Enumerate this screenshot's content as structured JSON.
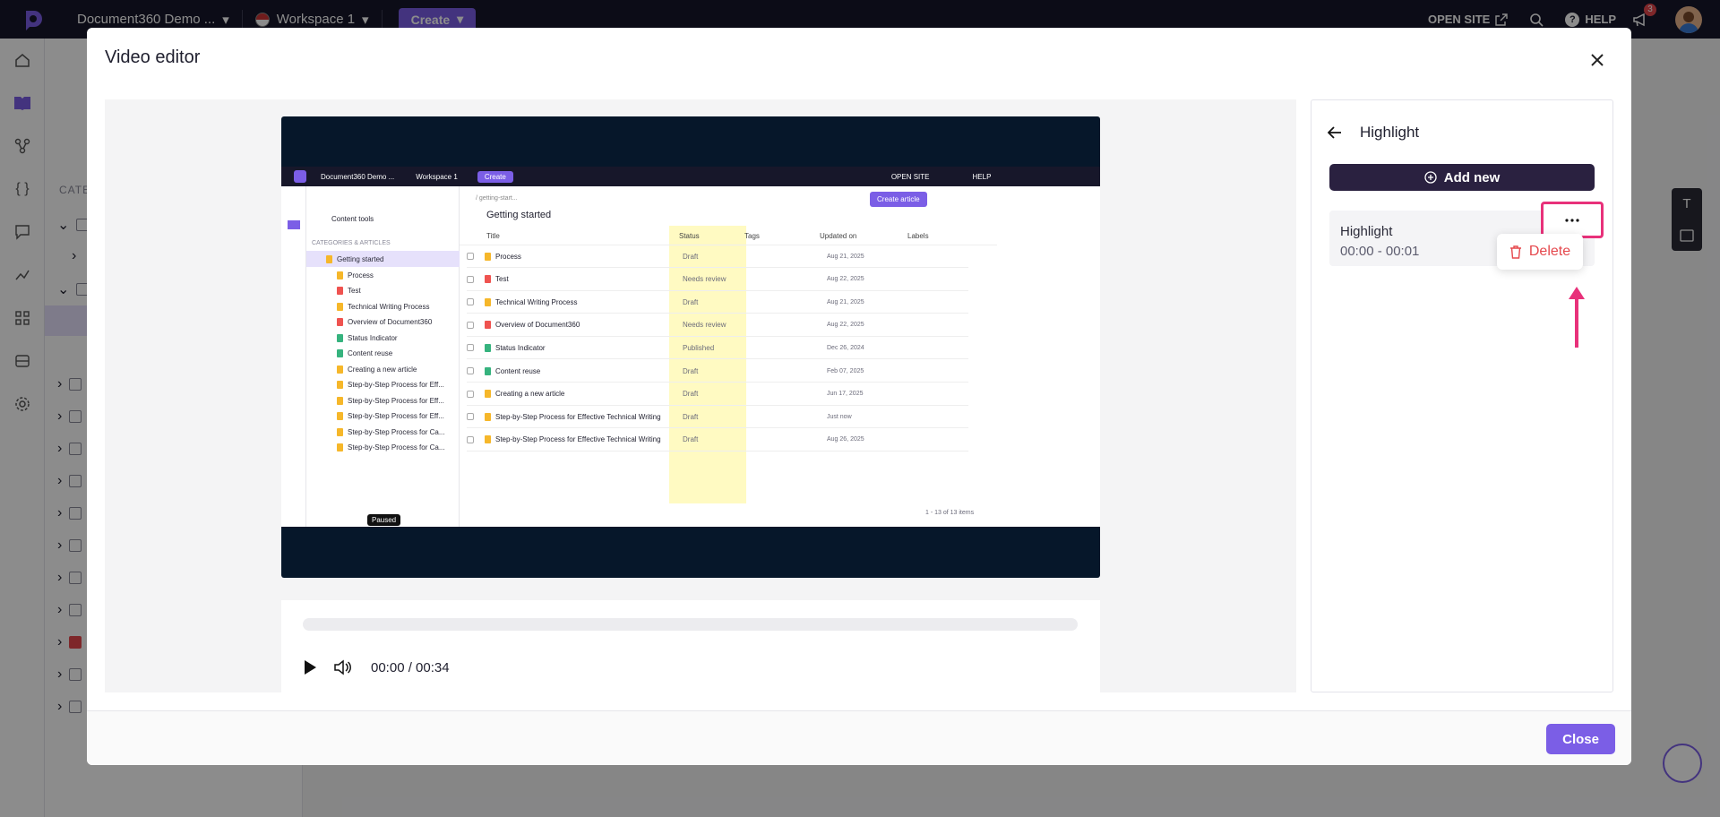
{
  "topnav": {
    "project": "Document360 Demo ...",
    "workspace": "Workspace 1",
    "create_label": "Create",
    "open_site": "OPEN SITE",
    "help": "HELP",
    "notif_count": "3"
  },
  "behind": {
    "categories_label": "CATE"
  },
  "modal": {
    "title": "Video editor",
    "close_label": "Close",
    "player": {
      "time": "00:00 / 00:34"
    },
    "highlight_panel": {
      "title": "Highlight",
      "add_new": "Add new",
      "items": [
        {
          "name": "Highlight",
          "range": "00:00 - 00:01"
        }
      ],
      "menu": {
        "delete": "Delete"
      }
    }
  },
  "video_frame": {
    "project": "Document360 Demo ...",
    "workspace": "Workspace 1",
    "create": "Create",
    "open_site": "OPEN SITE",
    "help": "HELP",
    "content_tools": "Content tools",
    "categories_label": "CATEGORIES & ARTICLES",
    "breadcrumb": "/ getting-start...",
    "page_title": "Getting started",
    "create_article": "Create article",
    "paused": "Paused",
    "pagination": "1 - 13 of 13 items",
    "tree": [
      {
        "label": "Getting started",
        "color": "#f6b72a"
      },
      {
        "label": "Process",
        "color": "#f6b72a"
      },
      {
        "label": "Test",
        "color": "#ef5350"
      },
      {
        "label": "Technical Writing Process",
        "color": "#f6b72a"
      },
      {
        "label": "Overview of Document360",
        "color": "#ef5350"
      },
      {
        "label": "Status Indicator",
        "color": "#36b37e"
      },
      {
        "label": "Content reuse",
        "color": "#36b37e"
      },
      {
        "label": "Creating a new article",
        "color": "#f6b72a"
      },
      {
        "label": "Step-by-Step Process for Eff...",
        "color": "#f6b72a"
      },
      {
        "label": "Step-by-Step Process for Eff...",
        "color": "#f6b72a"
      },
      {
        "label": "Step-by-Step Process for Eff...",
        "color": "#f6b72a"
      },
      {
        "label": "Step-by-Step Process for Ca...",
        "color": "#f6b72a"
      },
      {
        "label": "Step-by-Step Process for Ca...",
        "color": "#f6b72a"
      }
    ],
    "columns": [
      "Title",
      "Status",
      "Tags",
      "Updated on",
      "Labels"
    ],
    "rows": [
      {
        "title": "Process",
        "status": "Draft",
        "date": "Aug 21, 2025",
        "color": "#f6b72a"
      },
      {
        "title": "Test",
        "status": "Needs review",
        "date": "Aug 22, 2025",
        "color": "#ef5350"
      },
      {
        "title": "Technical Writing Process",
        "status": "Draft",
        "date": "Aug 21, 2025",
        "color": "#f6b72a"
      },
      {
        "title": "Overview of Document360",
        "status": "Needs review",
        "date": "Aug 22, 2025",
        "color": "#ef5350"
      },
      {
        "title": "Status Indicator",
        "status": "Published",
        "date": "Dec 26, 2024",
        "color": "#36b37e"
      },
      {
        "title": "Content reuse",
        "status": "Draft",
        "date": "Feb 07, 2025",
        "color": "#36b37e"
      },
      {
        "title": "Creating a new article",
        "status": "Draft",
        "date": "Jun 17, 2025",
        "color": "#f6b72a"
      },
      {
        "title": "Step-by-Step Process for Effective Technical Writing",
        "status": "Draft",
        "date": "Just now",
        "color": "#f6b72a"
      },
      {
        "title": "Step-by-Step Process for Effective Technical Writing",
        "status": "Draft",
        "date": "Aug 26, 2025",
        "color": "#f6b72a"
      }
    ]
  },
  "colors": {
    "accent": "#7b5ee6",
    "dark_button": "#2a2140",
    "highlight_border": "#e8317a",
    "delete": "#e5484d"
  }
}
